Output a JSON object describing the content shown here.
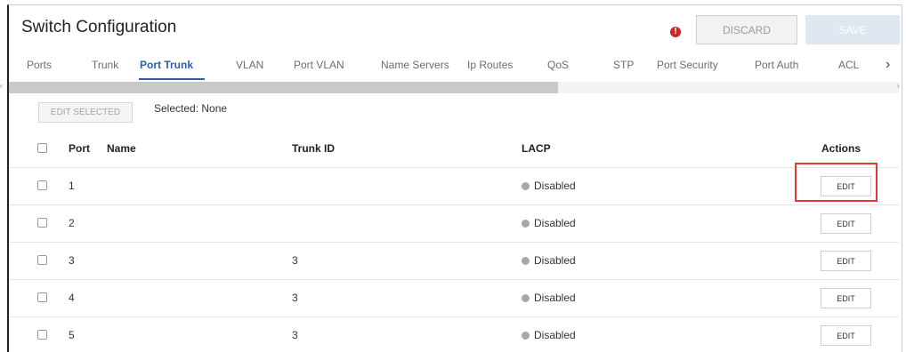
{
  "header": {
    "title": "Switch Configuration",
    "discard_label": "DISCARD",
    "save_label": "SAVE",
    "warning_glyph": "!"
  },
  "tabs": [
    {
      "label": "Ports"
    },
    {
      "label": "Trunk"
    },
    {
      "label": "Port Trunk",
      "active": true
    },
    {
      "label": "VLAN"
    },
    {
      "label": "Port VLAN"
    },
    {
      "label": "Name Servers"
    },
    {
      "label": "Ip Routes"
    },
    {
      "label": "QoS"
    },
    {
      "label": "STP"
    },
    {
      "label": "Port Security"
    },
    {
      "label": "Port Auth"
    },
    {
      "label": "ACL"
    }
  ],
  "toolbar": {
    "edit_selected_label": "EDIT SELECTED",
    "selected_text": "Selected: None"
  },
  "table": {
    "headers": {
      "port": "Port",
      "name": "Name",
      "trunk_id": "Trunk ID",
      "lacp": "LACP",
      "actions": "Actions"
    },
    "rows": [
      {
        "port": "1",
        "name": "",
        "trunk_id": "",
        "lacp": "Disabled",
        "action": "EDIT"
      },
      {
        "port": "2",
        "name": "",
        "trunk_id": "",
        "lacp": "Disabled",
        "action": "EDIT"
      },
      {
        "port": "3",
        "name": "",
        "trunk_id": "3",
        "lacp": "Disabled",
        "action": "EDIT"
      },
      {
        "port": "4",
        "name": "",
        "trunk_id": "3",
        "lacp": "Disabled",
        "action": "EDIT"
      },
      {
        "port": "5",
        "name": "",
        "trunk_id": "3",
        "lacp": "Disabled",
        "action": "EDIT"
      }
    ]
  },
  "colors": {
    "accent": "#2b5fa8",
    "warning": "#c62828",
    "highlight": "#e53935",
    "status_disabled": "#a7a7a7"
  },
  "icons": {
    "warning": "warning-icon",
    "tab_next": "chevron-right-icon",
    "status": "status-dot-icon"
  }
}
